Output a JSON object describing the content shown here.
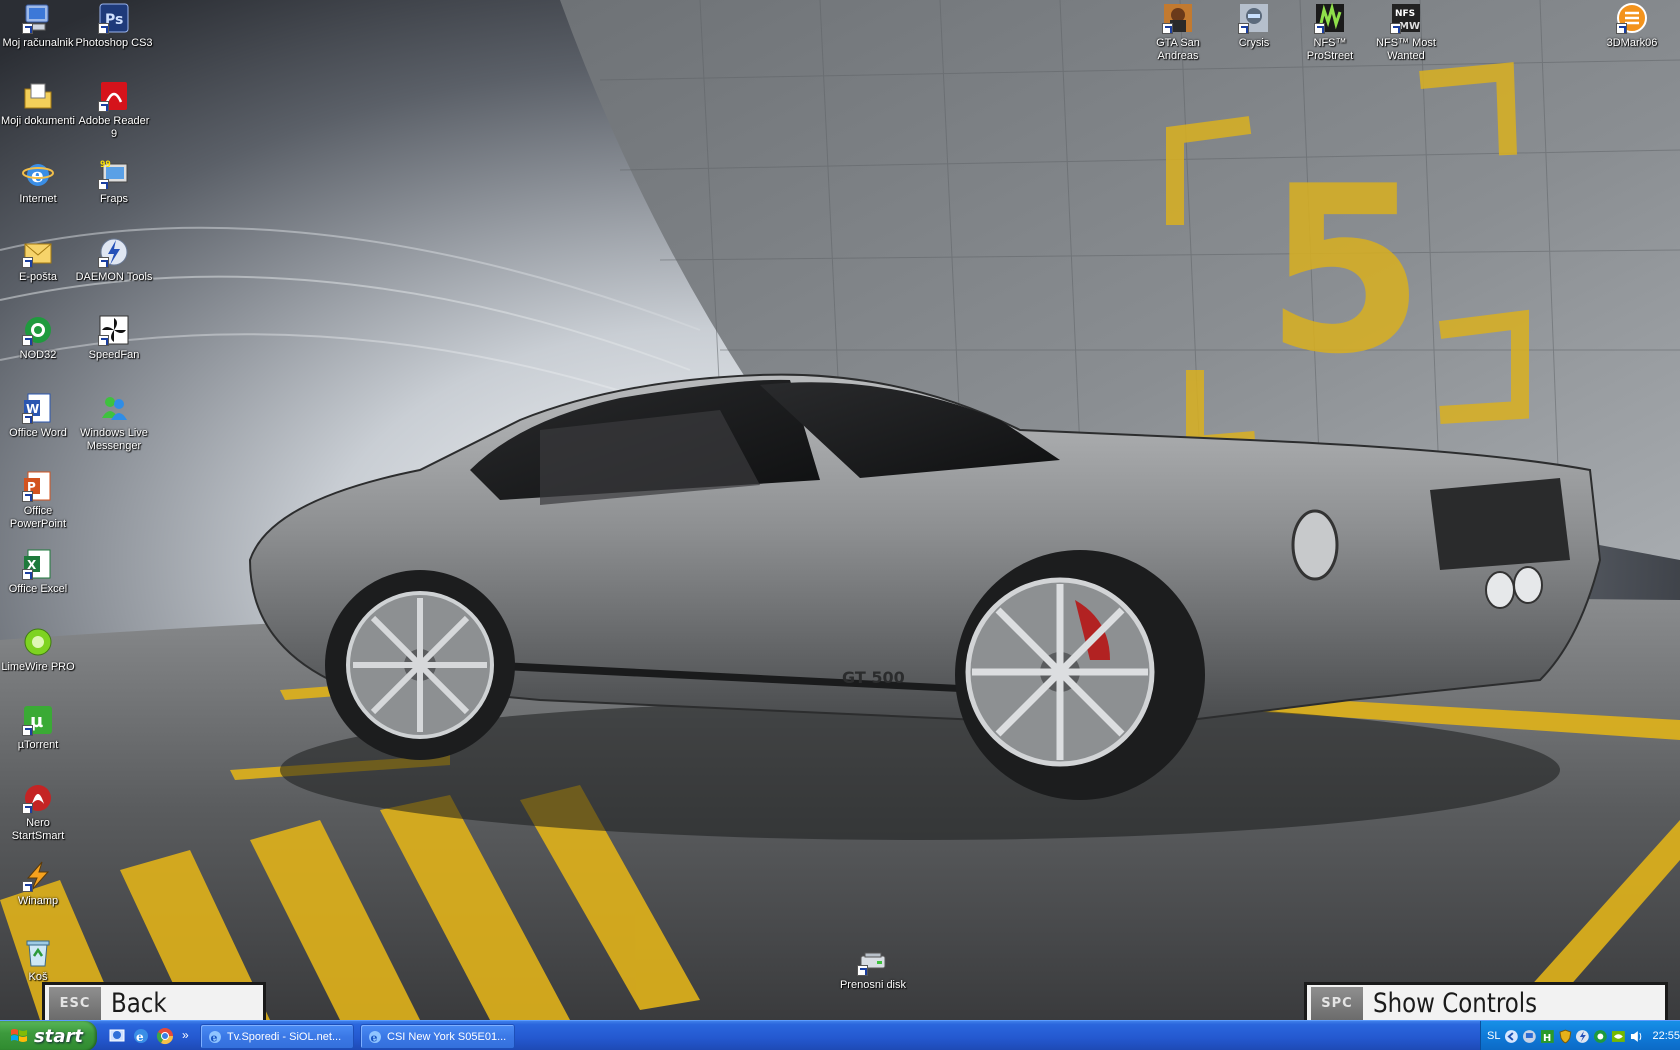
{
  "desktop": {
    "icons_left": [
      {
        "label": "Moj računalnik",
        "icon": "my-computer-icon"
      },
      {
        "label": "Photoshop CS3",
        "icon": "photoshop-icon"
      },
      {
        "label": "Moji dokumenti",
        "icon": "my-documents-icon"
      },
      {
        "label": "Adobe Reader 9",
        "icon": "adobe-reader-icon"
      },
      {
        "label": "Internet",
        "icon": "internet-explorer-icon"
      },
      {
        "label": "Fraps",
        "icon": "fraps-icon"
      },
      {
        "label": "E-pošta",
        "icon": "email-icon"
      },
      {
        "label": "DAEMON Tools",
        "icon": "daemon-tools-icon"
      },
      {
        "label": "NOD32",
        "icon": "nod32-icon"
      },
      {
        "label": "SpeedFan",
        "icon": "speedfan-icon"
      },
      {
        "label": "Office Word",
        "icon": "word-icon"
      },
      {
        "label": "Windows Live Messenger",
        "icon": "messenger-icon"
      },
      {
        "label": "Office PowerPoint",
        "icon": "powerpoint-icon"
      },
      {
        "label": "Office Excel",
        "icon": "excel-icon"
      },
      {
        "label": "LimeWire PRO",
        "icon": "limewire-icon"
      },
      {
        "label": "µTorrent",
        "icon": "utorrent-icon"
      },
      {
        "label": "Nero StartSmart",
        "icon": "nero-icon"
      },
      {
        "label": "Winamp",
        "icon": "winamp-icon"
      },
      {
        "label": "Koš",
        "icon": "recycle-bin-icon"
      }
    ],
    "icons_right": [
      {
        "label": "GTA San Andreas",
        "icon": "gta-icon"
      },
      {
        "label": "Crysis",
        "icon": "crysis-icon"
      },
      {
        "label": "NFS™ ProStreet",
        "icon": "nfs-prostreet-icon"
      },
      {
        "label": "NFS™ Most Wanted",
        "icon": "nfs-most-wanted-icon"
      },
      {
        "label": "3DMark06",
        "icon": "3dmark-icon"
      }
    ],
    "icons_bottom": [
      {
        "label": "Prenosni disk",
        "icon": "removable-disk-icon"
      }
    ]
  },
  "wallpaper": {
    "car_stripe_text": "GT 500",
    "wall_number": "5",
    "hud_back": {
      "key": "ESC",
      "label": "Back"
    },
    "hud_controls": {
      "key": "SPC",
      "label": "Show Controls"
    }
  },
  "taskbar": {
    "start_label": "start",
    "quicklaunch_more": "»",
    "tasks": [
      {
        "label": "Tv.Sporedi - SiOL.net...",
        "icon": "internet-explorer-icon"
      },
      {
        "label": "CSI New York S05E01...",
        "icon": "internet-explorer-icon"
      }
    ],
    "tray": {
      "language": "SL",
      "clock": "22:55"
    }
  },
  "colors": {
    "taskbar_blue": "#2458cf",
    "start_green": "#3d9a3d",
    "tray_blue": "#0f7ad9",
    "road_yellow": "#e0b21a"
  }
}
